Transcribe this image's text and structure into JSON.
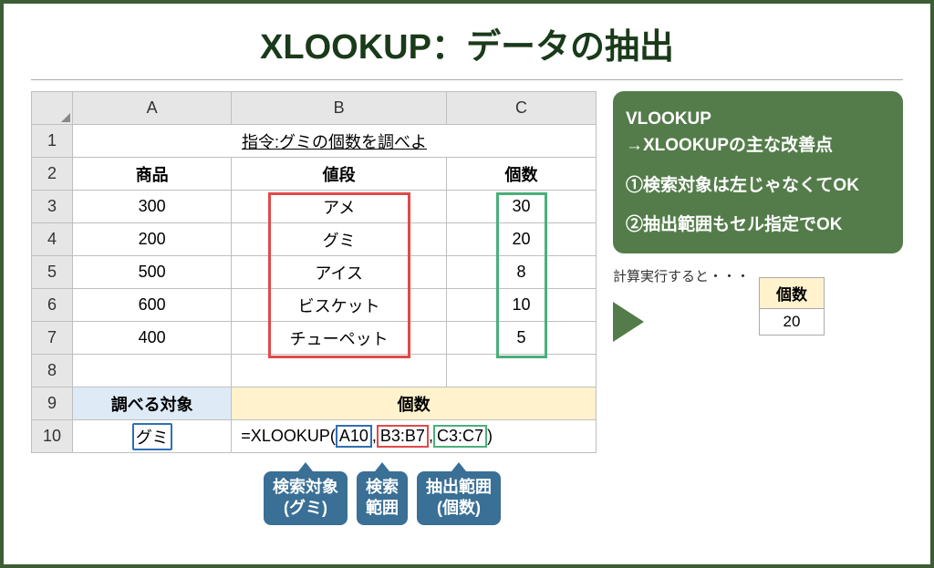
{
  "title": "XLOOKUP：データの抽出",
  "columns": {
    "A": "A",
    "B": "B",
    "C": "C"
  },
  "rows": [
    "1",
    "2",
    "3",
    "4",
    "5",
    "6",
    "7",
    "8",
    "9",
    "10"
  ],
  "instruction": "指令:グミの個数を調べよ",
  "headers2": {
    "a": "商品",
    "b": "値段",
    "c": "個数"
  },
  "data": [
    {
      "a": "300",
      "b": "アメ",
      "c": "30"
    },
    {
      "a": "200",
      "b": "グミ",
      "c": "20"
    },
    {
      "a": "500",
      "b": "アイス",
      "c": "8"
    },
    {
      "a": "600",
      "b": "ビスケット",
      "c": "10"
    },
    {
      "a": "400",
      "b": "チューペット",
      "c": "5"
    }
  ],
  "row9": {
    "a": "調べる対象",
    "bc": "個数"
  },
  "row10": {
    "a": "グミ",
    "formula": {
      "pre": "=XLOOKUP(",
      "a": "A10",
      "sep1": ",",
      "b": "B3:B7",
      "sep2": ",",
      "c": "C3:C7",
      "post": ")"
    }
  },
  "callouts": {
    "c1a": "検索対象",
    "c1b": "(グミ)",
    "c2a": "検索",
    "c2b": "範囲",
    "c3a": "抽出範囲",
    "c3b": "(個数)"
  },
  "panel": {
    "l1": "VLOOKUP",
    "l2": "→XLOOKUPの主な改善点",
    "l3": "①検索対象は左じゃなくてOK",
    "l4": "②抽出範囲もセル指定でOK"
  },
  "result": {
    "label": "計算実行すると・・・",
    "h": "個数",
    "v": "20"
  }
}
